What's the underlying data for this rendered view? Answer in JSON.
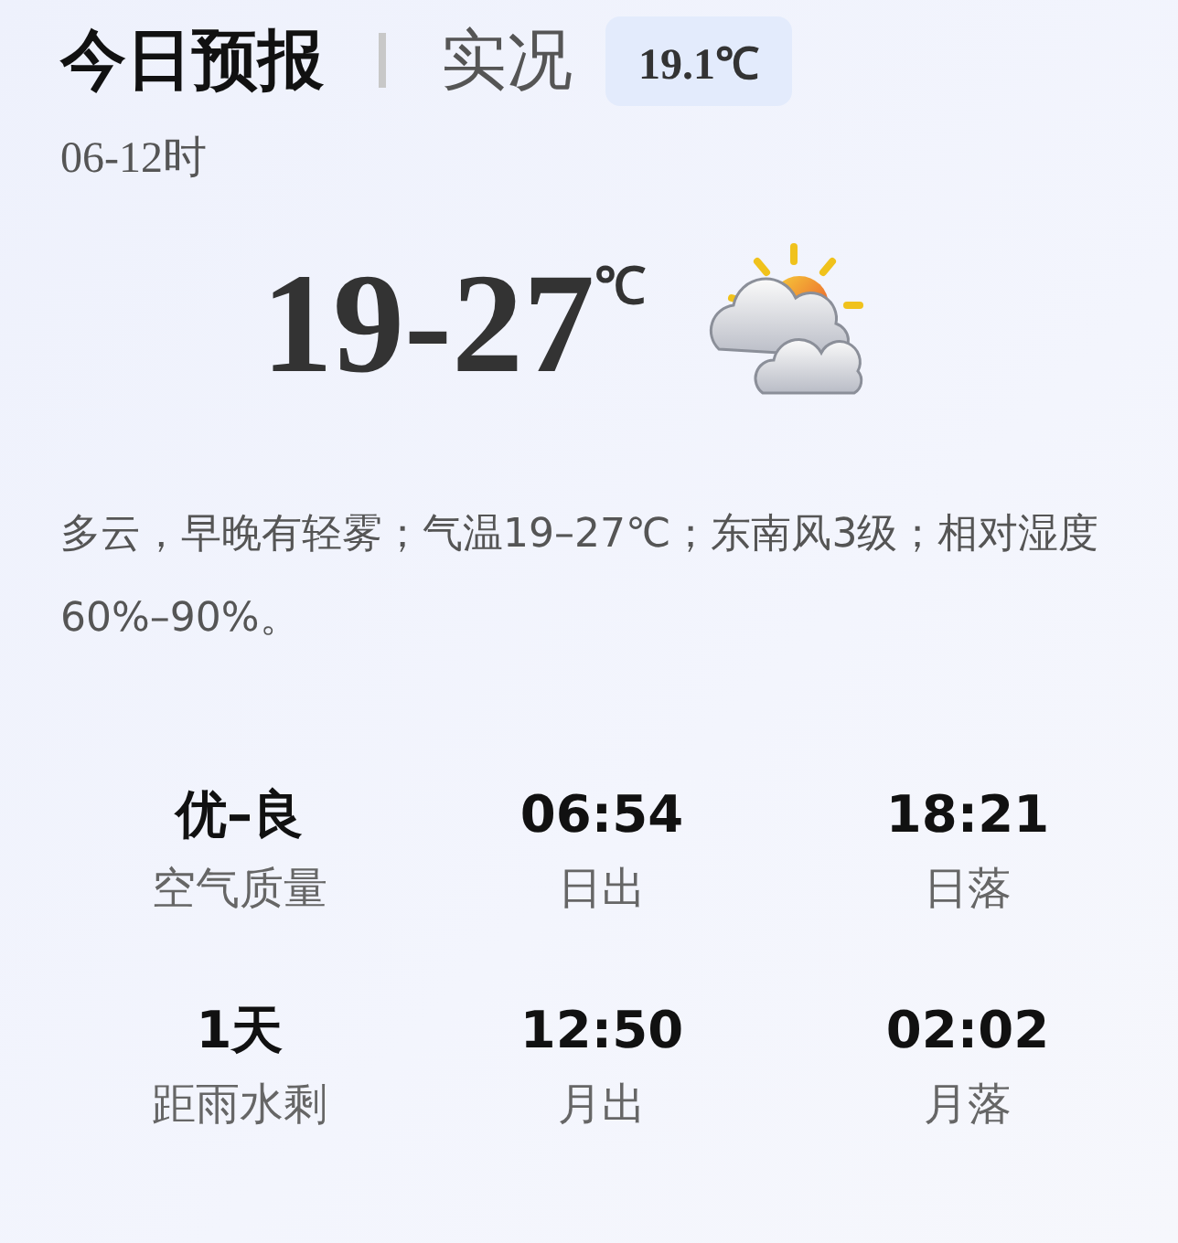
{
  "tabs": [
    {
      "label": "今日预报",
      "selected": true
    },
    {
      "label": "实况",
      "selected": false
    }
  ],
  "current_badge": "19.1℃",
  "period": "06-12时",
  "temperature": {
    "range": "19-27",
    "unit": "℃"
  },
  "description": "多云，早晚有轻雾；气温19–27℃；东南风3级；相对湿度60%–90%。",
  "stats": [
    {
      "value": "优–良",
      "label": "空气质量"
    },
    {
      "value": "06:54",
      "label": "日出"
    },
    {
      "value": "18:21",
      "label": "日落"
    },
    {
      "value": "1天",
      "label": "距雨水剩"
    },
    {
      "value": "12:50",
      "label": "月出"
    },
    {
      "value": "02:02",
      "label": "月落"
    }
  ]
}
